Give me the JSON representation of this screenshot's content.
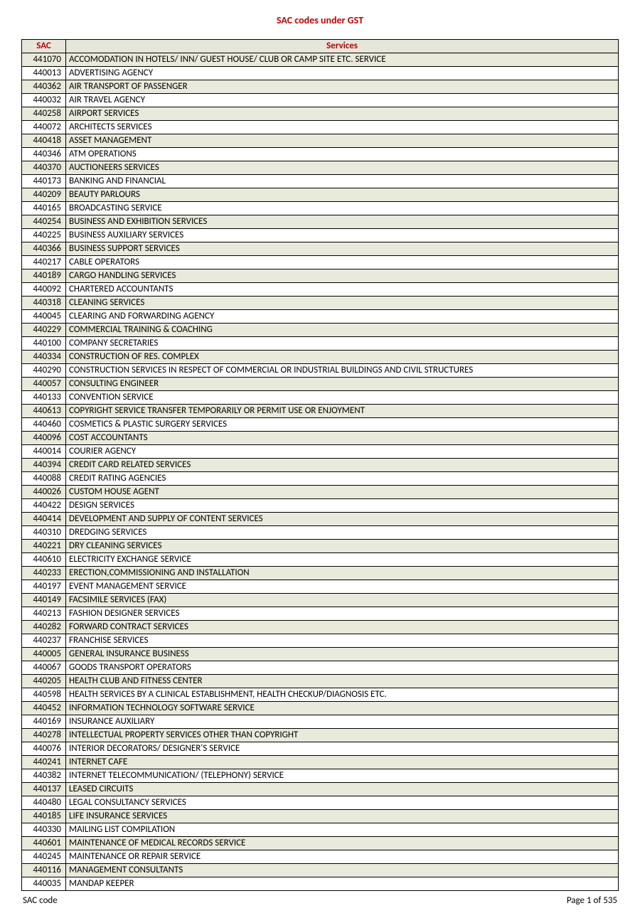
{
  "title": "SAC codes under GST",
  "headers": {
    "sac": "SAC",
    "services": "Services"
  },
  "footer": {
    "left": "SAC code",
    "right": "Page 1 of 535"
  },
  "rows": [
    {
      "sac": "441070",
      "service": "ACCOMODATION IN HOTELS/ INN/ GUEST HOUSE/ CLUB OR CAMP SITE ETC. SERVICE",
      "shaded": true
    },
    {
      "sac": "440013",
      "service": "ADVERTISING AGENCY",
      "shaded": false
    },
    {
      "sac": "440362",
      "service": "AIR TRANSPORT OF PASSENGER",
      "shaded": true
    },
    {
      "sac": "440032",
      "service": "AIR TRAVEL AGENCY",
      "shaded": false
    },
    {
      "sac": "440258",
      "service": "AIRPORT SERVICES",
      "shaded": true
    },
    {
      "sac": "440072",
      "service": "ARCHITECTS SERVICES",
      "shaded": false
    },
    {
      "sac": "440418",
      "service": "ASSET MANAGEMENT",
      "shaded": true
    },
    {
      "sac": "440346",
      "service": "ATM OPERATIONS",
      "shaded": false
    },
    {
      "sac": "440370",
      "service": "AUCTIONEERS SERVICES",
      "shaded": true
    },
    {
      "sac": "440173",
      "service": "BANKING AND FINANCIAL",
      "shaded": false
    },
    {
      "sac": "440209",
      "service": "BEAUTY PARLOURS",
      "shaded": true
    },
    {
      "sac": "440165",
      "service": "BROADCASTING SERVICE",
      "shaded": false
    },
    {
      "sac": "440254",
      "service": "BUSINESS AND EXHIBITION SERVICES",
      "shaded": true
    },
    {
      "sac": "440225",
      "service": "BUSINESS AUXILIARY SERVICES",
      "shaded": false
    },
    {
      "sac": "440366",
      "service": "BUSINESS SUPPORT SERVICES",
      "shaded": true
    },
    {
      "sac": "440217",
      "service": "CABLE OPERATORS",
      "shaded": false
    },
    {
      "sac": "440189",
      "service": "CARGO HANDLING SERVICES",
      "shaded": true
    },
    {
      "sac": "440092",
      "service": "CHARTERED ACCOUNTANTS",
      "shaded": false
    },
    {
      "sac": "440318",
      "service": "CLEANING SERVICES",
      "shaded": true
    },
    {
      "sac": "440045",
      "service": "CLEARING AND FORWARDING AGENCY",
      "shaded": false
    },
    {
      "sac": "440229",
      "service": "COMMERCIAL TRAINING & COACHING",
      "shaded": true
    },
    {
      "sac": "440100",
      "service": "COMPANY SECRETARIES",
      "shaded": false
    },
    {
      "sac": "440334",
      "service": "CONSTRUCTION OF RES. COMPLEX",
      "shaded": true
    },
    {
      "sac": "440290",
      "service": "CONSTRUCTION SERVICES IN RESPECT OF COMMERCIAL OR INDUSTRIAL BUILDINGS AND CIVIL STRUCTURES",
      "shaded": false
    },
    {
      "sac": "440057",
      "service": "CONSULTING ENGINEER",
      "shaded": true
    },
    {
      "sac": "440133",
      "service": "CONVENTION SERVICE",
      "shaded": false
    },
    {
      "sac": "440613",
      "service": "COPYRIGHT SERVICE TRANSFER TEMPORARILY OR PERMIT USE OR ENJOYMENT",
      "shaded": true
    },
    {
      "sac": "440460",
      "service": "COSMETICS & PLASTIC SURGERY SERVICES",
      "shaded": false
    },
    {
      "sac": "440096",
      "service": "COST ACCOUNTANTS",
      "shaded": true
    },
    {
      "sac": "440014",
      "service": "COURIER AGENCY",
      "shaded": false
    },
    {
      "sac": "440394",
      "service": "CREDIT CARD RELATED SERVICES",
      "shaded": true
    },
    {
      "sac": "440088",
      "service": "CREDIT RATING AGENCIES",
      "shaded": false
    },
    {
      "sac": "440026",
      "service": "CUSTOM HOUSE AGENT",
      "shaded": true
    },
    {
      "sac": "440422",
      "service": "DESIGN SERVICES",
      "shaded": false
    },
    {
      "sac": "440414",
      "service": "DEVELOPMENT AND SUPPLY OF CONTENT SERVICES",
      "shaded": true
    },
    {
      "sac": "440310",
      "service": "DREDGING SERVICES",
      "shaded": false
    },
    {
      "sac": "440221",
      "service": "DRY CLEANING SERVICES",
      "shaded": true
    },
    {
      "sac": "440610",
      "service": "ELECTRICITY EXCHANGE SERVICE",
      "shaded": false
    },
    {
      "sac": "440233",
      "service": "ERECTION,COMMISSIONING AND INSTALLATION",
      "shaded": true
    },
    {
      "sac": "440197",
      "service": "EVENT MANAGEMENT SERVICE",
      "shaded": false
    },
    {
      "sac": "440149",
      "service": "FACSIMILE SERVICES (FAX)",
      "shaded": true
    },
    {
      "sac": "440213",
      "service": "FASHION DESIGNER SERVICES",
      "shaded": false
    },
    {
      "sac": "440282",
      "service": "FORWARD CONTRACT SERVICES",
      "shaded": true
    },
    {
      "sac": "440237",
      "service": "FRANCHISE SERVICES",
      "shaded": false
    },
    {
      "sac": "440005",
      "service": "GENERAL INSURANCE BUSINESS",
      "shaded": true
    },
    {
      "sac": "440067",
      "service": "GOODS TRANSPORT OPERATORS",
      "shaded": false
    },
    {
      "sac": "440205",
      "service": "HEALTH CLUB AND FITNESS CENTER",
      "shaded": true
    },
    {
      "sac": "440598",
      "service": "HEALTH SERVICES BY A CLINICAL ESTABLISHMENT, HEALTH CHECKUP/DIAGNOSIS ETC.",
      "shaded": false
    },
    {
      "sac": "440452",
      "service": "INFORMATION TECHNOLOGY SOFTWARE SERVICE",
      "shaded": true
    },
    {
      "sac": "440169",
      "service": "INSURANCE AUXILIARY",
      "shaded": false
    },
    {
      "sac": "440278",
      "service": "INTELLECTUAL PROPERTY SERVICES OTHER THAN COPYRIGHT",
      "shaded": true
    },
    {
      "sac": "440076",
      "service": "INTERIOR DECORATORS/ DESIGNER'S SERVICE",
      "shaded": false
    },
    {
      "sac": "440241",
      "service": "INTERNET CAFE",
      "shaded": true
    },
    {
      "sac": "440382",
      "service": "INTERNET TELECOMMUNICATION/ (TELEPHONY) SERVICE",
      "shaded": false
    },
    {
      "sac": "440137",
      "service": "LEASED CIRCUITS",
      "shaded": true
    },
    {
      "sac": "440480",
      "service": "LEGAL CONSULTANCY SERVICES",
      "shaded": false
    },
    {
      "sac": "440185",
      "service": "LIFE INSURANCE SERVICES",
      "shaded": true
    },
    {
      "sac": "440330",
      "service": "MAILING LIST COMPILATION",
      "shaded": false
    },
    {
      "sac": "440601",
      "service": "MAINTENANCE OF MEDICAL RECORDS SERVICE",
      "shaded": true
    },
    {
      "sac": "440245",
      "service": "MAINTENANCE OR REPAIR SERVICE",
      "shaded": false
    },
    {
      "sac": "440116",
      "service": "MANAGEMENT CONSULTANTS",
      "shaded": true
    },
    {
      "sac": "440035",
      "service": "MANDAP KEEPER",
      "shaded": false
    }
  ]
}
